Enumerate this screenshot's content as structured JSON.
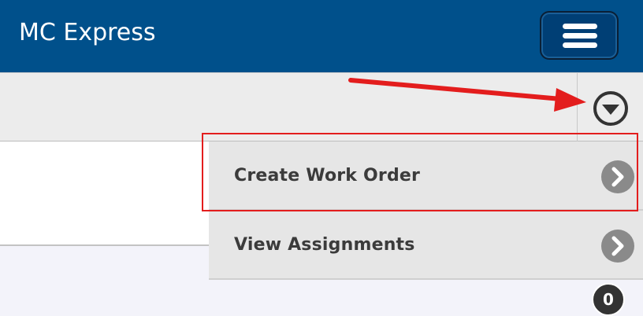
{
  "header": {
    "title": "MC Express",
    "menu_icon": "hamburger-icon",
    "background_color": "#00508b"
  },
  "toolbar": {
    "toggle_icon": "dropdown-circle-icon"
  },
  "dropdown": {
    "items": [
      {
        "label": "Create Work Order",
        "icon": "chevron-right-icon"
      },
      {
        "label": "View Assignments",
        "icon": "chevron-right-icon"
      }
    ]
  },
  "badge": {
    "count": "0"
  },
  "annotations": {
    "highlight_color": "#e31d1d",
    "arrow_color": "#e31d1d"
  }
}
